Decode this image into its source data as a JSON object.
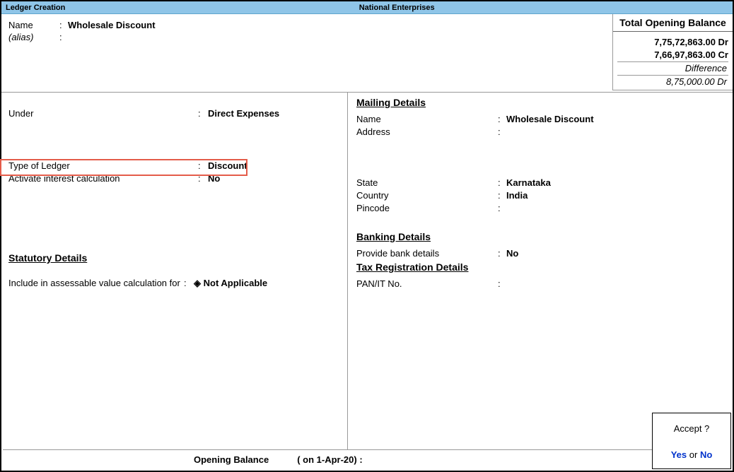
{
  "titlebar": {
    "left": "Ledger Creation",
    "center": "National Enterprises"
  },
  "header": {
    "name_label": "Name",
    "alias_label": "(alias)",
    "name_value": "Wholesale Discount",
    "alias_value": ""
  },
  "opening_balance": {
    "title": "Total Opening Balance",
    "dr": "7,75,72,863.00 Dr",
    "cr": "7,66,97,863.00 Cr",
    "diff_label": "Difference",
    "diff_value": "8,75,000.00 Dr"
  },
  "left": {
    "under_label": "Under",
    "under_value": "Direct Expenses",
    "type_label": "Type of Ledger",
    "type_value": "Discount",
    "interest_label": "Activate interest calculation",
    "interest_value": "No",
    "stat_heading": "Statutory Details",
    "assessable_label": "Include in assessable value calculation for",
    "assessable_value": "◈ Not Applicable"
  },
  "right": {
    "mailing_heading": "Mailing Details",
    "m_name_label": "Name",
    "m_name_value": "Wholesale Discount",
    "m_addr_label": "Address",
    "m_addr_value": "",
    "m_state_label": "State",
    "m_state_value": "Karnataka",
    "m_country_label": "Country",
    "m_country_value": "India",
    "m_pin_label": "Pincode",
    "m_pin_value": "",
    "banking_heading": "Banking Details",
    "bank_label": "Provide bank details",
    "bank_value": "No",
    "tax_heading": "Tax Registration Details",
    "pan_label": "PAN/IT No.",
    "pan_value": ""
  },
  "bottom": {
    "label": "Opening Balance",
    "date": "( on 1-Apr-20)  :"
  },
  "accept": {
    "question": "Accept ?",
    "yes": "Yes",
    "or": " or ",
    "no": "No"
  }
}
